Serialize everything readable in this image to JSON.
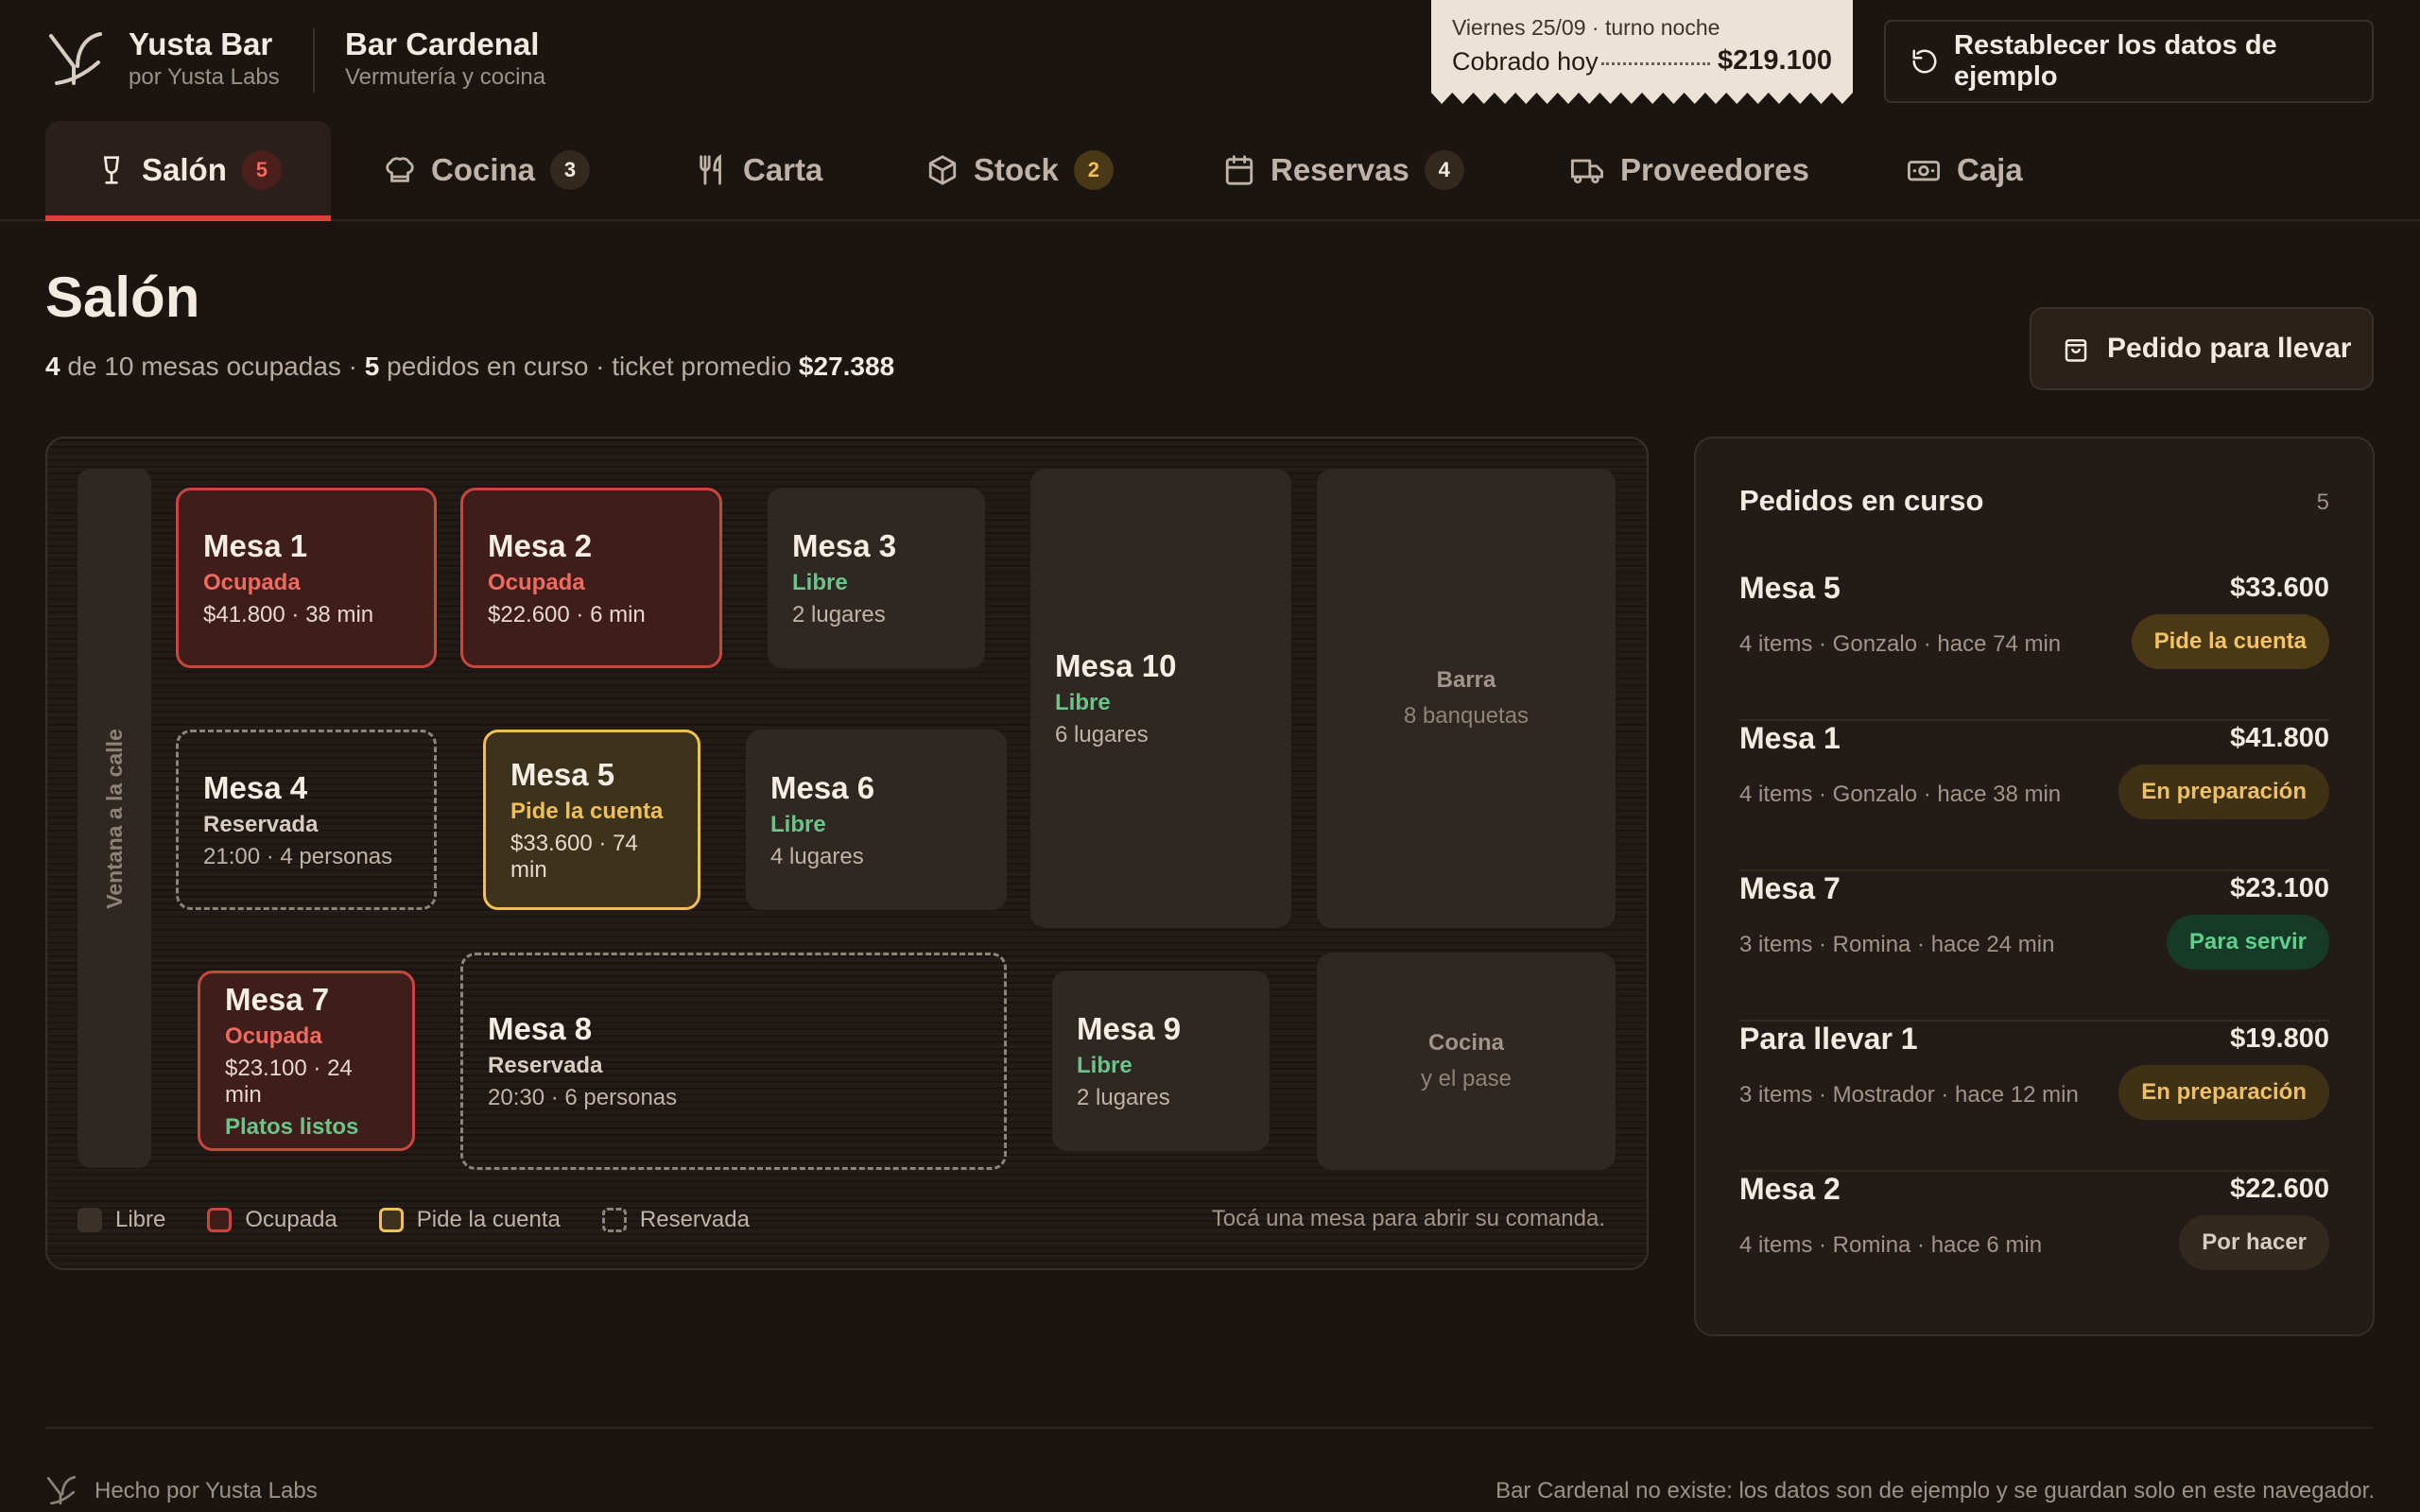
{
  "brand": {
    "name": "Yusta Bar",
    "subtitle": "por Yusta Labs"
  },
  "bar": {
    "name": "Bar Cardenal",
    "subtitle": "Vermutería y cocina"
  },
  "receipt": {
    "date": "Viernes 25/09 · turno noche",
    "label": "Cobrado hoy",
    "amount": "$219.100"
  },
  "reset_button": {
    "label": "Restablecer los datos de ejemplo",
    "icon": "reset-icon"
  },
  "tabs": [
    {
      "label": "Salón",
      "badge": "5",
      "icon": "wine-glass-icon",
      "active": true
    },
    {
      "label": "Cocina",
      "badge": "3",
      "icon": "chef-hat-icon"
    },
    {
      "label": "Carta",
      "badge": "",
      "icon": "utensils-icon"
    },
    {
      "label": "Stock",
      "badge": "2",
      "icon": "box-icon"
    },
    {
      "label": "Reservas",
      "badge": "4",
      "icon": "calendar-icon"
    },
    {
      "label": "Proveedores",
      "badge": "",
      "icon": "truck-icon"
    },
    {
      "label": "Caja",
      "badge": "",
      "icon": "cash-icon"
    }
  ],
  "page": {
    "title": "Salón",
    "occupied": "4",
    "stats_a": " de 10 mesas ocupadas · ",
    "orders_count": "5",
    "stats_b": " pedidos en curso · ticket promedio ",
    "avg_ticket": "$27.388"
  },
  "takeaway_button": {
    "label": "Pedido para llevar",
    "icon": "shopping-bag-icon"
  },
  "floor": {
    "window_label": "Ventana a la calle",
    "tables": [
      {
        "name": "Mesa 1",
        "status": "Ocupada",
        "detail": "$41.800 · 38 min",
        "extra": ""
      },
      {
        "name": "Mesa 2",
        "status": "Ocupada",
        "detail": "$22.600 · 6 min",
        "extra": ""
      },
      {
        "name": "Mesa 3",
        "status": "Libre",
        "detail": "2 lugares",
        "extra": ""
      },
      {
        "name": "Mesa 4",
        "status": "Reservada",
        "detail": "21:00 · 4 personas",
        "extra": ""
      },
      {
        "name": "Mesa 5",
        "status": "Pide la cuenta",
        "detail": "$33.600 · 74 min",
        "extra": ""
      },
      {
        "name": "Mesa 6",
        "status": "Libre",
        "detail": "4 lugares",
        "extra": ""
      },
      {
        "name": "Mesa 7",
        "status": "Ocupada",
        "detail": "$23.100 · 24 min",
        "extra": "Platos listos"
      },
      {
        "name": "Mesa 8",
        "status": "Reservada",
        "detail": "20:30 · 6 personas",
        "extra": ""
      },
      {
        "name": "Mesa 9",
        "status": "Libre",
        "detail": "2 lugares",
        "extra": ""
      },
      {
        "name": "Mesa 10",
        "status": "Libre",
        "detail": "6 lugares",
        "extra": ""
      }
    ],
    "zones": [
      {
        "title": "Barra",
        "subtitle": "8 banquetas"
      },
      {
        "title": "Cocina",
        "subtitle": "y el pase"
      }
    ],
    "legend": [
      "Libre",
      "Ocupada",
      "Pide la cuenta",
      "Reservada"
    ],
    "hint": "Tocá una mesa para abrir su comanda."
  },
  "orders": {
    "title": "Pedidos en curso",
    "count": "5",
    "items": [
      {
        "name": "Mesa 5",
        "amount": "$33.600",
        "meta": "4 items · Gonzalo · hace 74 min",
        "status": "Pide la cuenta"
      },
      {
        "name": "Mesa 1",
        "amount": "$41.800",
        "meta": "4 items · Gonzalo · hace 38 min",
        "status": "En preparación"
      },
      {
        "name": "Mesa 7",
        "amount": "$23.100",
        "meta": "3 items · Romina · hace 24 min",
        "status": "Para servir"
      },
      {
        "name": "Para llevar 1",
        "amount": "$19.800",
        "meta": "3 items · Mostrador · hace 12 min",
        "status": "En preparación"
      },
      {
        "name": "Mesa 2",
        "amount": "$22.600",
        "meta": "4 items · Romina · hace 6 min",
        "status": "Por hacer"
      }
    ]
  },
  "footer": {
    "left": "Hecho por Yusta Labs",
    "right": "Bar Cardenal no existe: los datos son de ejemplo y se guardan solo en este navegador."
  },
  "colors": {
    "background": "#1b1511",
    "accent_red": "#d8433a",
    "occupied": "#c8463d",
    "bill": "#f0c055",
    "free": "#6cc48a"
  }
}
